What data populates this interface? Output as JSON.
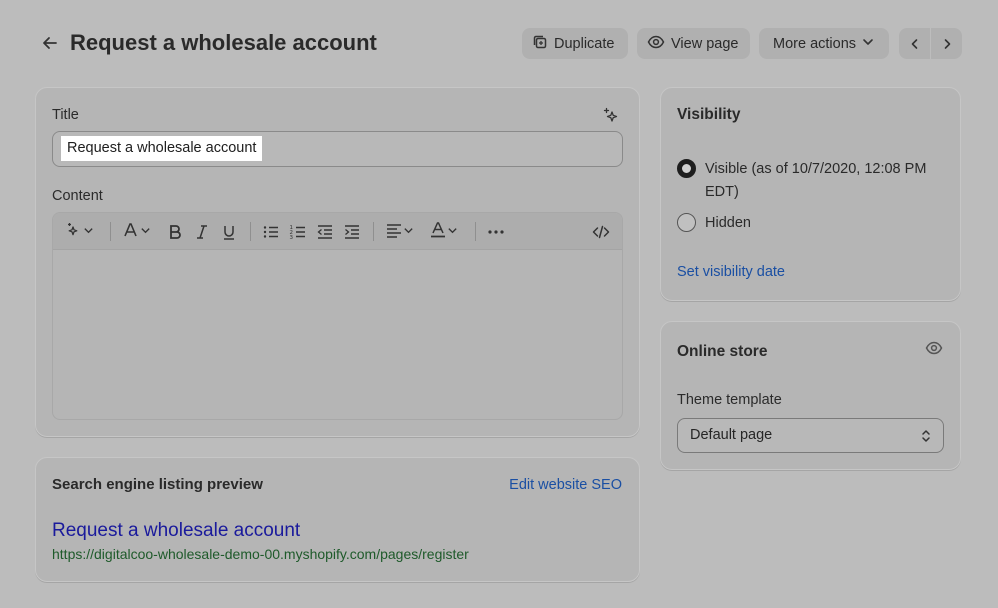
{
  "header": {
    "title": "Request a wholesale account",
    "duplicate_label": "Duplicate",
    "view_page_label": "View page",
    "more_actions_label": "More actions"
  },
  "main_card": {
    "title_label": "Title",
    "title_value": "Request a wholesale account",
    "content_label": "Content"
  },
  "visibility": {
    "heading": "Visibility",
    "visible_label": "Visible (as of 10/7/2020, 12:08 PM EDT)",
    "hidden_label": "Hidden",
    "selected": "visible",
    "set_date_link": "Set visibility date"
  },
  "online_store": {
    "heading": "Online store",
    "theme_template_label": "Theme template",
    "theme_template_value": "Default page"
  },
  "seo": {
    "heading": "Search engine listing preview",
    "edit_link": "Edit website SEO",
    "preview_title": "Request a wholesale account",
    "preview_url": "https://digitalcoo-wholesale-demo-00.myshopify.com/pages/register"
  },
  "colors": {
    "overlay_background": "#bcbcbc",
    "card_background": "#b5b5b5",
    "link": "#1a4fa3",
    "seo_title": "#1a1a9c",
    "seo_url": "#1e5a2a"
  }
}
